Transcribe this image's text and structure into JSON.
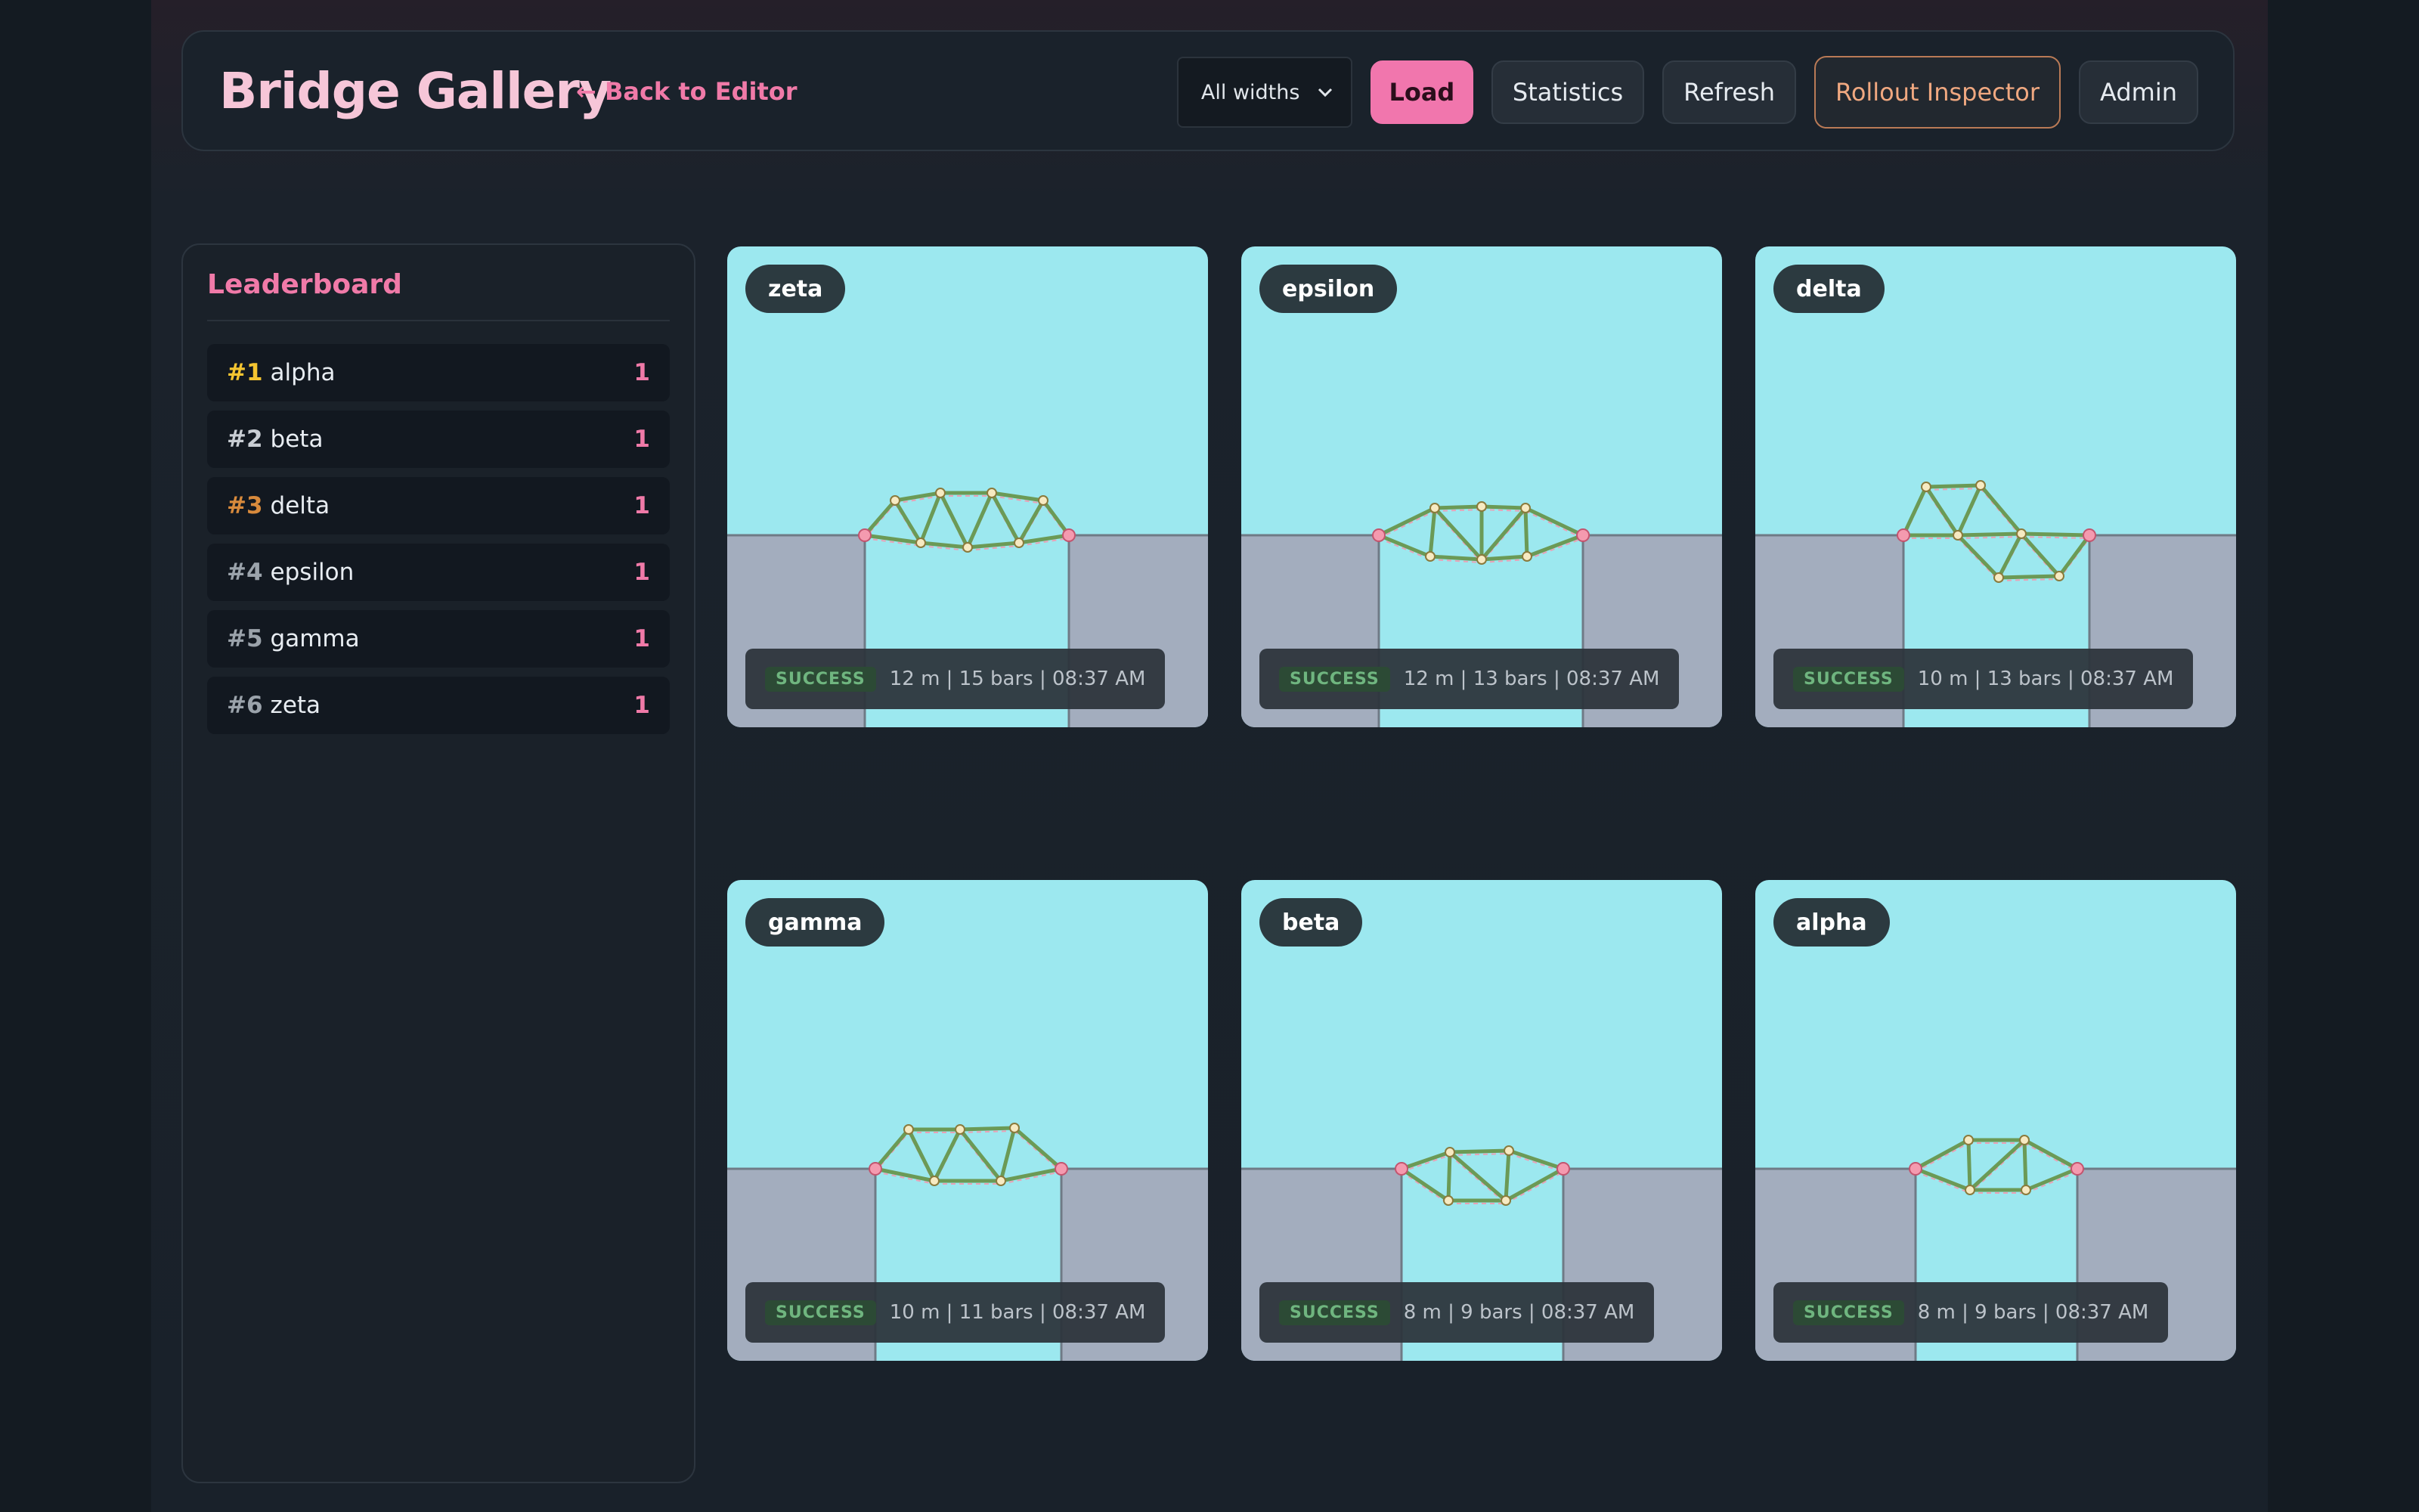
{
  "header": {
    "title": "Bridge Gallery",
    "back_link": "← Back to Editor",
    "width_filter": "All widths",
    "load": "Load",
    "statistics": "Statistics",
    "refresh": "Refresh",
    "rollout_inspector": "Rollout Inspector",
    "admin": "Admin"
  },
  "leaderboard": {
    "title": "Leaderboard",
    "rows": [
      {
        "rank": "#1",
        "name": "alpha",
        "score": "1",
        "rank_color": "#f4c531"
      },
      {
        "rank": "#2",
        "name": "beta",
        "score": "1",
        "rank_color": "#c9ced4"
      },
      {
        "rank": "#3",
        "name": "delta",
        "score": "1",
        "rank_color": "#d88a3c"
      },
      {
        "rank": "#4",
        "name": "epsilon",
        "score": "1",
        "rank_color": "#9ba3ab"
      },
      {
        "rank": "#5",
        "name": "gamma",
        "score": "1",
        "rank_color": "#9ba3ab"
      },
      {
        "rank": "#6",
        "name": "zeta",
        "score": "1",
        "rank_color": "#9ba3ab"
      }
    ]
  },
  "cards": [
    {
      "name": "zeta",
      "status": "SUCCESS",
      "info": "12 m | 15 bars | 08:37 AM"
    },
    {
      "name": "epsilon",
      "status": "SUCCESS",
      "info": "12 m | 13 bars | 08:37 AM"
    },
    {
      "name": "delta",
      "status": "SUCCESS",
      "info": "10 m | 13 bars | 08:37 AM"
    },
    {
      "name": "gamma",
      "status": "SUCCESS",
      "info": "10 m | 11 bars | 08:37 AM"
    },
    {
      "name": "beta",
      "status": "SUCCESS",
      "info": "8 m | 9 bars | 08:37 AM"
    },
    {
      "name": "alpha",
      "status": "SUCCESS",
      "info": "8 m | 9 bars | 08:37 AM"
    }
  ],
  "colors": {
    "accent": "#f07aa8",
    "sky": "#9ce8ef",
    "ground": "#a3adbe",
    "bar": "#6b9a56",
    "success": "#6fb57f"
  }
}
